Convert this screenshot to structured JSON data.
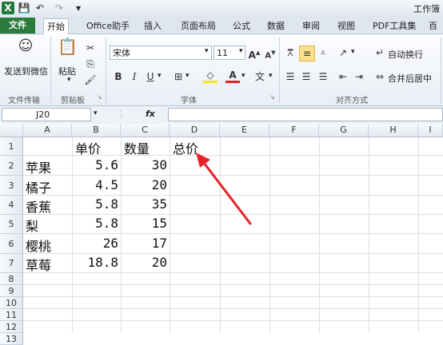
{
  "window": {
    "title": "工作簿"
  },
  "quick_access": {
    "save": "💾",
    "undo": "↶",
    "redo": "↷"
  },
  "tabs": [
    {
      "label": "文件"
    },
    {
      "label": "开始"
    },
    {
      "label": "Office助手"
    },
    {
      "label": "插入"
    },
    {
      "label": "页面布局"
    },
    {
      "label": "公式"
    },
    {
      "label": "数据"
    },
    {
      "label": "审阅"
    },
    {
      "label": "视图"
    },
    {
      "label": "PDF工具集"
    },
    {
      "label": "百度"
    }
  ],
  "ribbon": {
    "send_wechat": "发送到微信",
    "paste": "粘贴",
    "font_name": "宋体",
    "font_size": "11",
    "auto_wrap": "自动换行",
    "merge_center": "合并后居中",
    "groups": {
      "transfer": "文件传输",
      "clipboard": "剪贴板",
      "font": "字体",
      "alignment": "对齐方式"
    }
  },
  "formula_bar": {
    "name_box": "J20",
    "fx": "fx",
    "content": ""
  },
  "columns": [
    "A",
    "B",
    "C",
    "D",
    "E",
    "F",
    "G",
    "H",
    "I"
  ],
  "rows": [
    "1",
    "2",
    "3",
    "4",
    "5",
    "6",
    "7",
    "8",
    "9",
    "10",
    "11",
    "12",
    "13"
  ],
  "table": {
    "header": {
      "b": "单价",
      "c": "数量",
      "d": "总价"
    },
    "data": [
      {
        "a": "苹果",
        "b": "5.6",
        "c": "30"
      },
      {
        "a": "橘子",
        "b": "4.5",
        "c": "20"
      },
      {
        "a": "香蕉",
        "b": "5.8",
        "c": "35"
      },
      {
        "a": "梨",
        "b": "5.8",
        "c": "15"
      },
      {
        "a": "樱桃",
        "b": "26",
        "c": "17"
      },
      {
        "a": "草莓",
        "b": "18.8",
        "c": "20"
      }
    ]
  },
  "annotation_color": "#e8232a"
}
